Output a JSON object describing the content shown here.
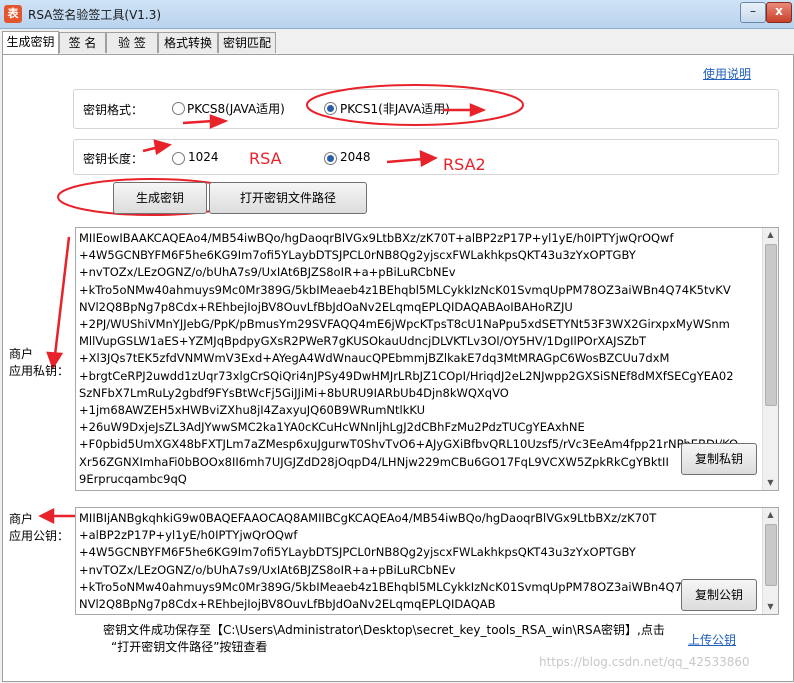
{
  "window": {
    "icon": "app-icon",
    "title": "RSA签名验签工具(V1.3)",
    "minimize": "–",
    "close": "x"
  },
  "tabs": [
    "生成密钥",
    "签 名",
    "验 签",
    "格式转换",
    "密钥匹配"
  ],
  "help_link": "使用说明",
  "format": {
    "label": "密钥格式：",
    "option1": "PKCS8(JAVA适用)",
    "option2": "PKCS1(非JAVA适用)",
    "selected": "PKCS1(非JAVA适用)"
  },
  "length": {
    "label": "密钥长度：",
    "option1": "1024",
    "option2": "2048",
    "selected": "2048"
  },
  "annotations": {
    "rsa": "RSA",
    "rsa2": "RSA2"
  },
  "buttons": {
    "generate": "生成密钥",
    "open_path": "打开密钥文件路径",
    "copy_private": "复制私钥",
    "copy_public": "复制公钥"
  },
  "private_key": {
    "label_line1": "商户",
    "label_line2": "应用私钥：",
    "lines": [
      "MIIEowIBAAKCAQEAo4/MB54iwBQo/hgDaoqrBlVGx9LtbBXz/zK70T+alBP2zP17P+yl1yE/h0IPTYjwQrOQwf",
      "+4W5GCNBYFM6F5he6KG9Im7ofi5YLaybDTSJPCL0rNB8Qg2yjscxFWLakhkpsQKT43u3zYxOPTGBY",
      "+nvTOZx/LEzOGNZ/o/bUhA7s9/UxIAt6BJZS8oIR+a+pBiLuRCbNEv",
      "+kTro5oNMw40ahmuys9Mc0Mr389G/5kbIMeaeb4z1BEhqbl5MLCykkIzNcK01SvmqUpPM78OZ3aiWBn4Q74K5tvKV",
      "NVl2Q8BpNg7p8Cdx+REhbejIojBV8OuvLfBbJdOaNv2ELqmqEPLQIDAQABAoIBAHoRZJU",
      "+2PJ/WUShiVMnYJJebG/PpK/pBmusYm29SVFAQQ4mE6jWpcKTpsT8cU1NaPpu5xdSETYNt53F3WX2GirxpxMyWSnm",
      "MllVupGSLW1aES+YZMJqBpdpyGXsR2PWeR7gKUSOkauUdncjDLVKTLv3Ol/OY5HV/1DgIlPOrXAJSZbT",
      "+Xl3JQs7tEK5zfdVNMWmV3Exd+AYegA4WdWnaucQPEbmmjBZlkakE7dq3MtMRAGpC6WosBZCUu7dxM",
      "+brgtCeRPJ2uwdd1zUqr73xlgCrSQiQri4nJPSy49DwHMJrLRbJZ1COpI/HriqdJ2eL2NJwpp2GXSiSNEf8dMXfSECgYEA02",
      "SzNFbX7LmRuLy2gbdf9FYsBtWcFj5GiJJiMi+8bURU9IARbUb4Djn8kWQXqVO",
      "+1jm68AWZEH5xHWBviZXhu8jI4ZaxyuJQ60B9WRumNtlkKU",
      "+26uW9DxjeJsZL3AdJYwwSMC2ka1YA0cKCuHcWNnljhLgJ2dCBhFzMu2PdzTUCgYEAxhNE",
      "+F0pbid5UmXGX48bFXTJLm7aZMesp6xuJgurwT0ShvTvO6+AJyGXiBfbvQRL10Uzsf5/rVc3EeAm4fpp21rNPhEBDJ/KO",
      "Xr56ZGNXImhaFi0bBOOx8II6mh7UJGJZdD28jOqpD4/LHNjw229mCBu6GO17FqL9VCXW5ZpkRkCgYBktII",
      "9Erprucqambc9qQ"
    ]
  },
  "public_key": {
    "label_line1": "商户",
    "label_line2": "应用公钥：",
    "lines": [
      "MIIBIjANBgkqhkiG9w0BAQEFAAOCAQ8AMIIBCgKCAQEAo4/MB54iwBQo/hgDaoqrBlVGx9LtbBXz/zK70T",
      "+alBP2zP17P+yl1yE/h0IPTYjwQrOQwf",
      "+4W5GCNBYFM6F5he6KG9Im7ofi5YLaybDTSJPCL0rNB8Qg2yjscxFWLakhkpsQKT43u3zYxOPTGBY",
      "+nvTOZx/LEzOGNZ/o/bUhA7s9/UxIAt6BJZS8oIR+a+pBiLuRCbNEv",
      "+kTro5oNMw40ahmuys9Mc0Mr389G/5kbIMeaeb4z1BEhqbl5MLCykkIzNcK01SvmqUpPM78OZ3aiWBn4Q74K5tvKV",
      "NVl2Q8BpNg7p8Cdx+REhbejIojBV8OuvLfBbJdOaNv2ELqmqEPLQIDAQAB"
    ]
  },
  "status": {
    "line1": "密钥文件成功保存至【C:\\Users\\Administrator\\Desktop\\secret_key_tools_RSA_win\\RSA密钥】,点击",
    "line2": "“打开密钥文件路径”按钮查看"
  },
  "upload_link": "上传公钥",
  "watermark": "https://blog.csdn.net/qq_42533860",
  "colors": {
    "annotation": "#e8222a",
    "link": "#1f5fbf"
  }
}
